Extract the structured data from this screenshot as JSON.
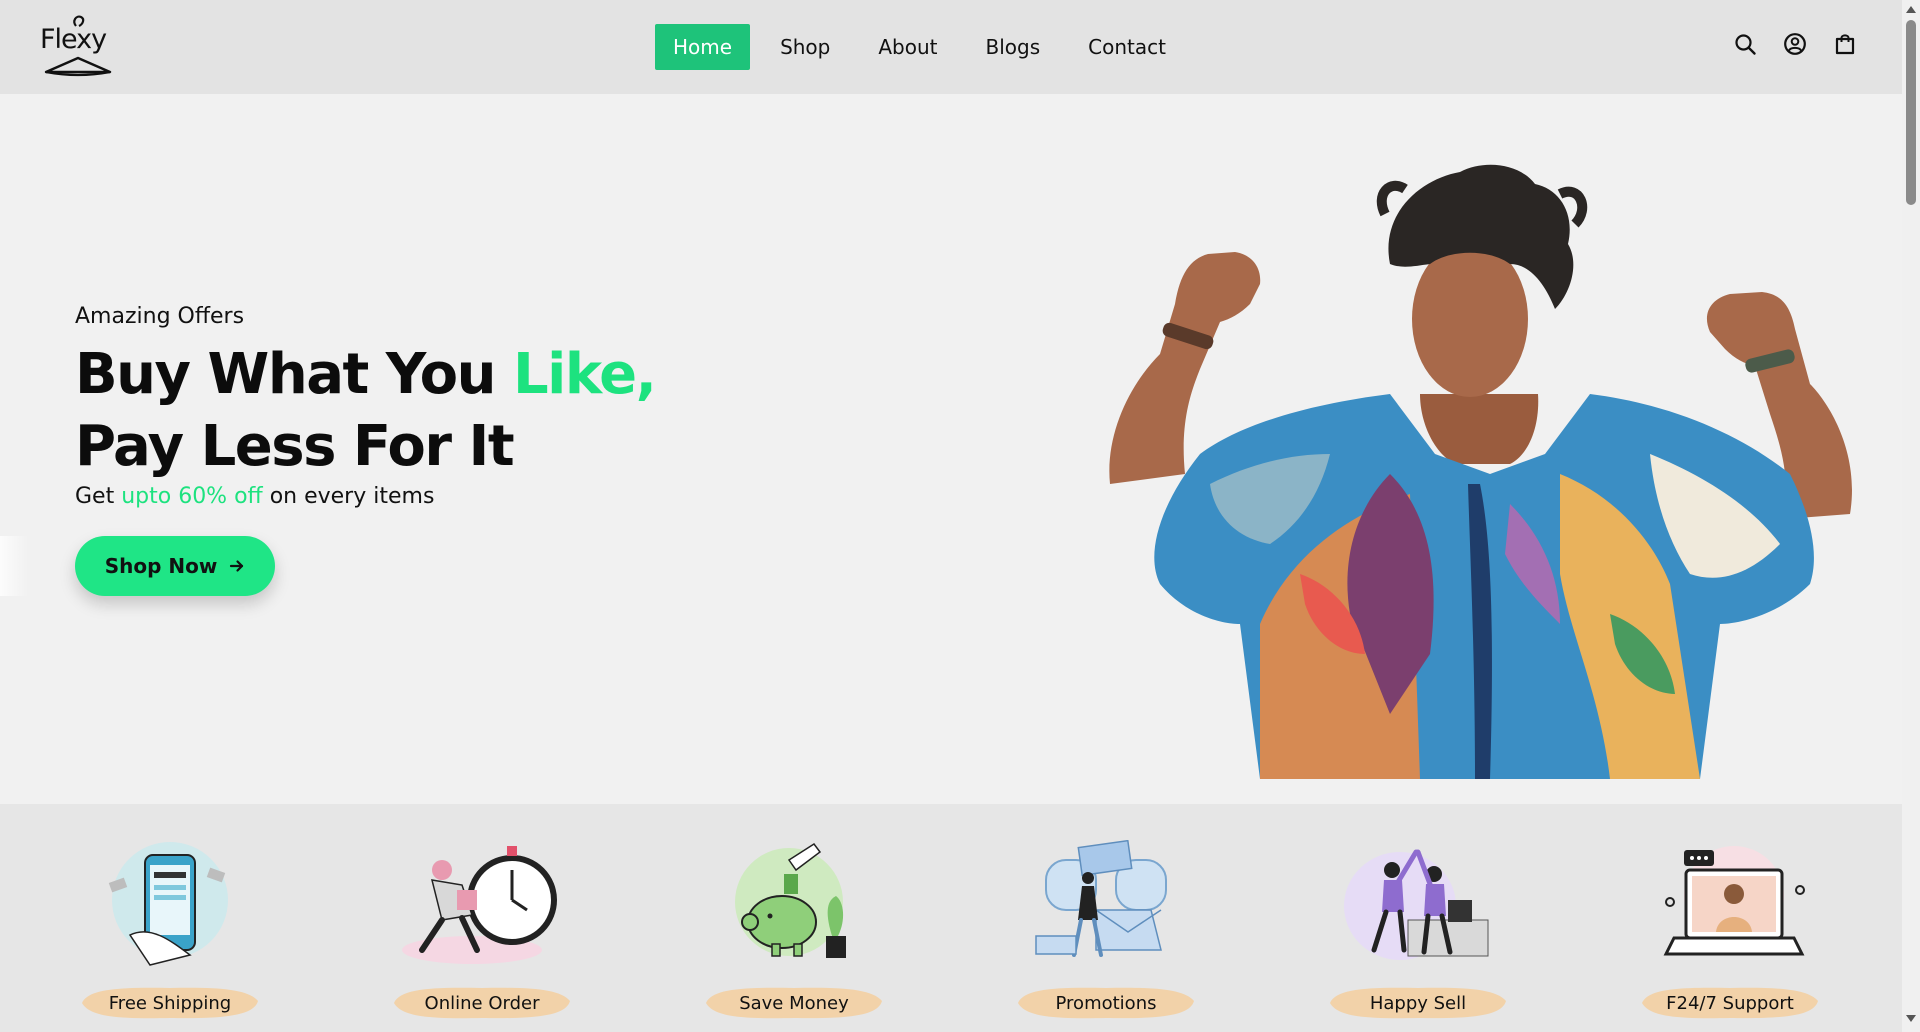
{
  "header": {
    "logo_text": "Flexy",
    "nav": [
      {
        "label": "Home",
        "active": true
      },
      {
        "label": "Shop",
        "active": false
      },
      {
        "label": "About",
        "active": false
      },
      {
        "label": "Blogs",
        "active": false
      },
      {
        "label": "Contact",
        "active": false
      }
    ],
    "icons": [
      "search-icon",
      "user-account-icon",
      "shopping-bag-icon"
    ]
  },
  "hero": {
    "kicker": "Amazing Offers",
    "title_line1_part1": "Buy What You ",
    "title_line1_accent": "Like,",
    "title_line2": "Pay Less For It",
    "sub_prefix": "Get ",
    "sub_accent": "upto 60% off",
    "sub_suffix": " on every items",
    "cta_label": "Shop Now"
  },
  "features": [
    {
      "label": "Free Shipping",
      "icon": "payment-phone-illustration"
    },
    {
      "label": "Online Order",
      "icon": "clock-delivery-illustration"
    },
    {
      "label": "Save Money",
      "icon": "piggy-bank-illustration"
    },
    {
      "label": "Promotions",
      "icon": "promotion-illustration"
    },
    {
      "label": "Happy Sell",
      "icon": "high-five-illustration"
    },
    {
      "label": "F24/7 Support",
      "icon": "support-laptop-illustration"
    }
  ],
  "colors": {
    "accent": "#1de27f",
    "nav_active": "#1ec37a",
    "header_bg": "#e3e3e3",
    "feature_label_bg": "#f2d2a9"
  }
}
